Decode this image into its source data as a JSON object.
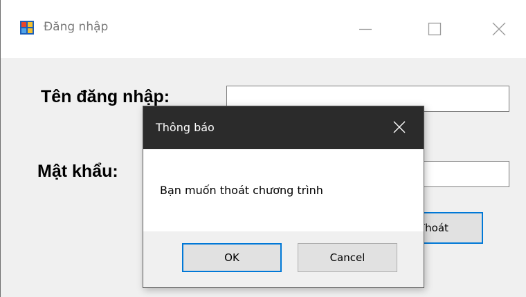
{
  "window": {
    "title": "Đăng nhập",
    "icon": "windows-form-icon",
    "controls": [
      "minimize-icon",
      "maximize-icon",
      "close-icon"
    ]
  },
  "form": {
    "username_label": "Tên đăng nhập:",
    "username_value": "",
    "password_label": "Mật khẩu:",
    "password_value": "",
    "exit_button_label": "Thoát"
  },
  "dialog": {
    "title": "Thông báo",
    "message": "Bạn muốn thoát chương trình",
    "ok_label": "OK",
    "cancel_label": "Cancel",
    "close_icon": "close-icon"
  },
  "colors": {
    "accent": "#0078d7",
    "dialog_titlebar": "#2b2b2b",
    "window_background": "#f0f0f0"
  }
}
